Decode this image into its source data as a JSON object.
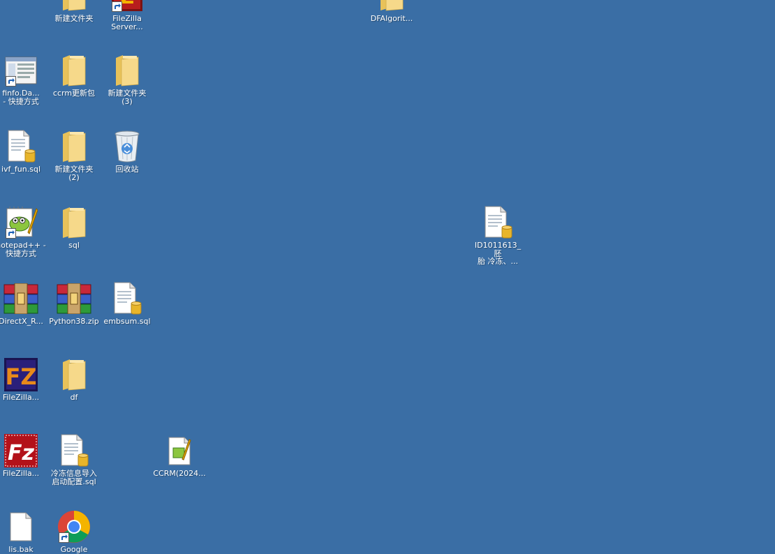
{
  "desktop": {
    "background": "#3a6ea5",
    "icons": [
      {
        "id": "folder-new-1",
        "label": "新建文件夹",
        "icon": "folder-icon",
        "shortcut": false
      },
      {
        "id": "filezilla-server",
        "label": "FileZilla\nServer...",
        "icon": "filezilla-server-icon",
        "shortcut": true
      },
      {
        "id": "dfalgorit",
        "label": "DFAlgorit...",
        "icon": "folder-icon",
        "shortcut": false
      },
      {
        "id": "finfo",
        "label": "finfo.Da...\n- 快捷方式",
        "icon": "window-app-icon",
        "shortcut": true
      },
      {
        "id": "ccrm-update",
        "label": "ccrm更新包",
        "icon": "folder-icon",
        "shortcut": false
      },
      {
        "id": "folder-new-3",
        "label": "新建文件夹\n(3)",
        "icon": "folder-icon",
        "shortcut": false
      },
      {
        "id": "ivf-fun-sql",
        "label": "ivf_fun.sql",
        "icon": "sql-file-icon",
        "shortcut": false
      },
      {
        "id": "folder-new-2",
        "label": "新建文件夹\n(2)",
        "icon": "folder-icon",
        "shortcut": false
      },
      {
        "id": "recycle-bin",
        "label": "回收站",
        "icon": "recycle-bin-icon",
        "shortcut": false
      },
      {
        "id": "notepadpp",
        "label": "notepad++ -\n快捷方式",
        "icon": "notepadpp-icon",
        "shortcut": true
      },
      {
        "id": "sql-folder",
        "label": "sql",
        "icon": "folder-icon",
        "shortcut": false
      },
      {
        "id": "id1011613",
        "label": "ID1011613_胚\n胎 冷冻、...",
        "icon": "sql-file-icon",
        "shortcut": false
      },
      {
        "id": "directx",
        "label": "DirectX_R...",
        "icon": "winrar-icon",
        "shortcut": false
      },
      {
        "id": "python38",
        "label": "Python38.zip",
        "icon": "winrar-icon",
        "shortcut": false
      },
      {
        "id": "embsum-sql",
        "label": "embsum.sql",
        "icon": "sql-file-icon",
        "shortcut": false
      },
      {
        "id": "filezilla-1",
        "label": "FileZilla...",
        "icon": "filezilla-server-icon",
        "shortcut": false
      },
      {
        "id": "df-folder",
        "label": "df",
        "icon": "folder-icon",
        "shortcut": false
      },
      {
        "id": "filezilla-2",
        "label": "FileZilla...",
        "icon": "filezilla-client-icon",
        "shortcut": false
      },
      {
        "id": "freeze-import",
        "label": "冷冻信息导入\n启动配置.sql",
        "icon": "sql-file-icon",
        "shortcut": false
      },
      {
        "id": "ccrm-2024",
        "label": "CCRM(2024...",
        "icon": "notepad-file-icon",
        "shortcut": false
      },
      {
        "id": "lis-bak",
        "label": "lis.bak",
        "icon": "blank-file-icon",
        "shortcut": false
      },
      {
        "id": "google",
        "label": "Google",
        "icon": "chrome-icon",
        "shortcut": true
      }
    ]
  }
}
